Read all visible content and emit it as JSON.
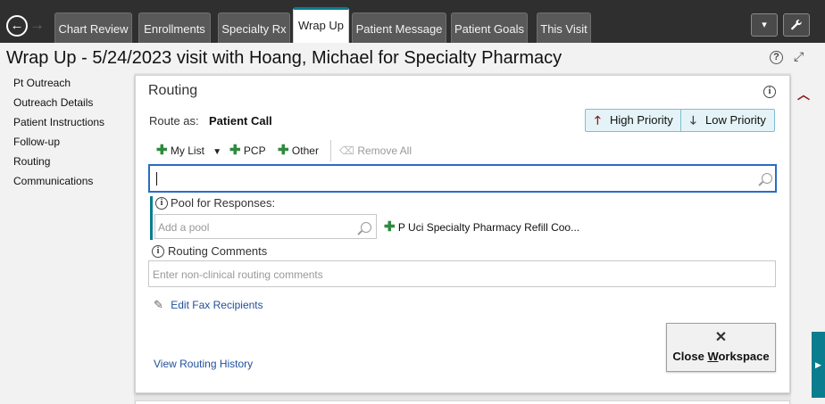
{
  "nav": {
    "back_glyph": "←",
    "forward_glyph": "→"
  },
  "tabs": [
    {
      "label": "Chart Review"
    },
    {
      "label": "Enrollments"
    },
    {
      "label": "Specialty Rx"
    },
    {
      "label": "Wrap Up",
      "active": true
    },
    {
      "label": "Patient Message"
    },
    {
      "label": "Patient Goals"
    },
    {
      "label": "This Visit"
    }
  ],
  "toolbar": {
    "dropdown_icon": "caret-down-icon",
    "settings_icon": "wrench-icon"
  },
  "page": {
    "title": "Wrap Up - 5/24/2023 visit with Hoang, Michael for Specialty Pharmacy"
  },
  "sidebar": {
    "items": [
      {
        "label": "Pt Outreach"
      },
      {
        "label": "Outreach Details"
      },
      {
        "label": "Patient Instructions"
      },
      {
        "label": "Follow-up"
      },
      {
        "label": "Routing"
      },
      {
        "label": "Communications"
      }
    ]
  },
  "routing": {
    "title": "Routing",
    "route_as_label": "Route as:",
    "route_as_value": "Patient Call",
    "priority": {
      "high_label": "High Priority",
      "low_label": "Low Priority"
    },
    "toolbar": {
      "my_list_label": "My List",
      "pcp_label": "PCP",
      "other_label": "Other",
      "remove_all_label": "Remove All"
    },
    "recipient_value": "",
    "pool_label": "Pool for Responses:",
    "pool_placeholder": "Add a pool",
    "pool_selected": "P Uci Specialty Pharmacy Refill Coo...",
    "comments_label": "Routing Comments",
    "comments_placeholder": "Enter non-clinical routing comments",
    "edit_fax_label": "Edit Fax Recipients",
    "history_label": "View Routing History",
    "close_label_pre": "Close ",
    "close_label_mnemonic": "W",
    "close_label_post": "orkspace"
  },
  "colors": {
    "accent": "#0a7d8f",
    "high_priority": "#8b1a1a",
    "link": "#1f4f9c",
    "add": "#2e8b3d"
  }
}
